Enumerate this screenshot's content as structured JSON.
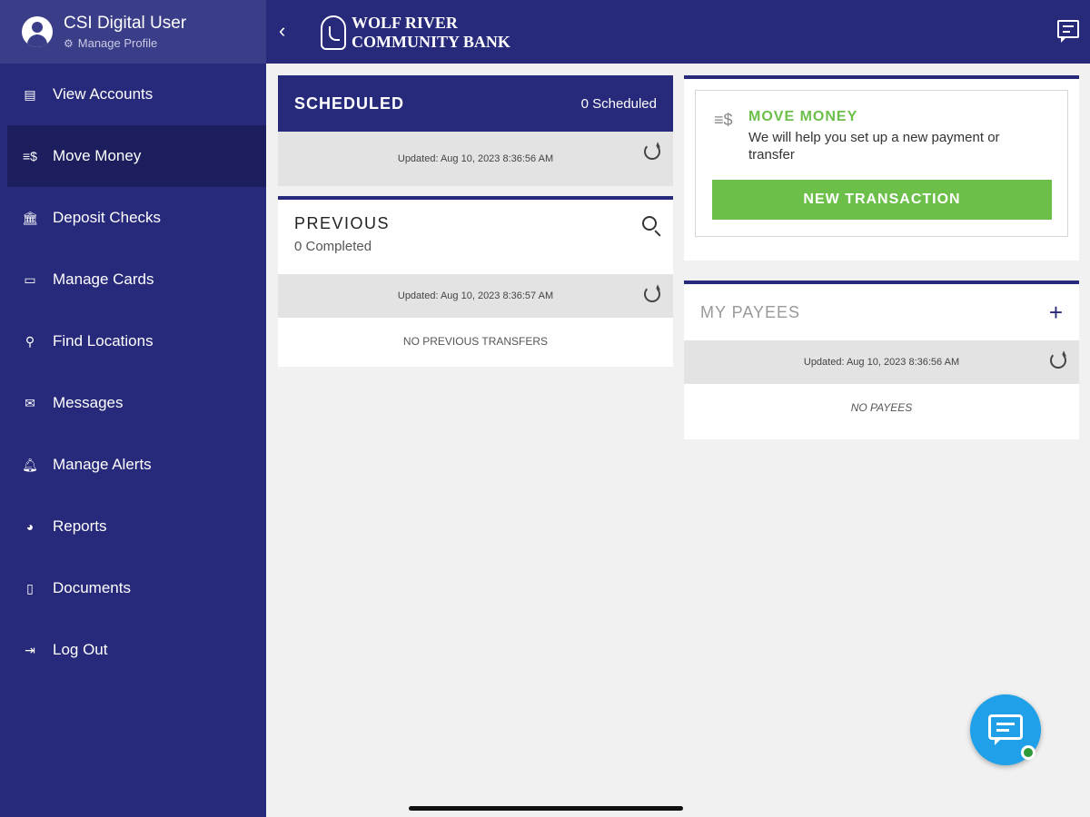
{
  "profile": {
    "name": "CSI Digital User",
    "manage_label": "Manage Profile"
  },
  "sidebar": {
    "items": [
      {
        "label": "View Accounts",
        "icon": "accounts-icon"
      },
      {
        "label": "Move Money",
        "icon": "move-money-icon",
        "active": true
      },
      {
        "label": "Deposit Checks",
        "icon": "bank-icon"
      },
      {
        "label": "Manage Cards",
        "icon": "card-icon"
      },
      {
        "label": "Find Locations",
        "icon": "location-pin-icon"
      },
      {
        "label": "Messages",
        "icon": "envelope-icon"
      },
      {
        "label": "Manage Alerts",
        "icon": "bell-icon"
      },
      {
        "label": "Reports",
        "icon": "pie-chart-icon"
      },
      {
        "label": "Documents",
        "icon": "document-icon"
      },
      {
        "label": "Log Out",
        "icon": "logout-icon"
      }
    ]
  },
  "header": {
    "bank_line1": "WOLF RIVER",
    "bank_line2": "COMMUNITY BANK"
  },
  "scheduled": {
    "title": "SCHEDULED",
    "count": "0 Scheduled",
    "updated": "Updated: Aug 10, 2023 8:36:56 AM"
  },
  "previous": {
    "title": "PREVIOUS",
    "subtitle": "0 Completed",
    "updated": "Updated: Aug 10, 2023 8:36:57 AM",
    "empty": "NO PREVIOUS TRANSFERS"
  },
  "move_money": {
    "title": "MOVE MONEY",
    "description": "We will help you set up a new payment or transfer",
    "button": "NEW TRANSACTION"
  },
  "payees": {
    "title": "MY PAYEES",
    "updated": "Updated: Aug 10, 2023 8:36:56 AM",
    "empty": "NO PAYEES"
  },
  "colors": {
    "primary": "#27297a",
    "accent_green": "#6cc04a",
    "chat_blue": "#1fa0e8"
  }
}
